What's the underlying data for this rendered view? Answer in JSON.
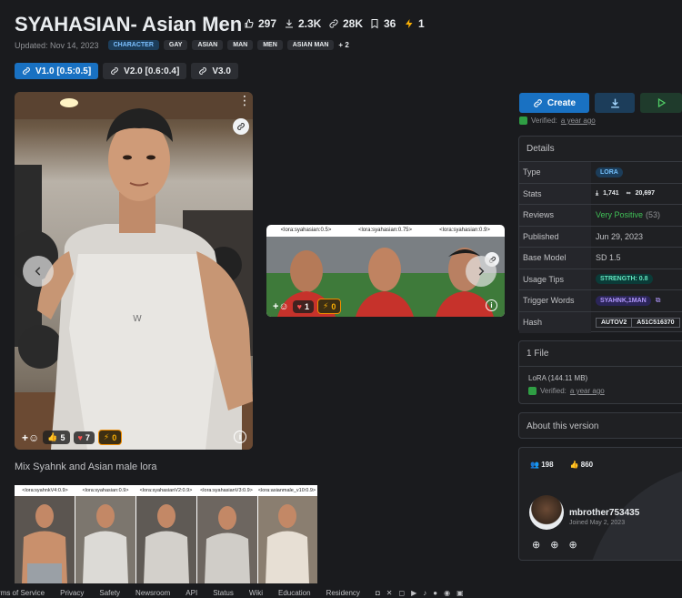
{
  "title": "SYAHASIAN- Asian Men",
  "stats": {
    "likes": "297",
    "downloads": "2.3K",
    "generations": "28K",
    "saves": "36",
    "buzz": "1"
  },
  "updated": "Updated: Nov 14, 2023",
  "tags": [
    "CHARACTER",
    "GAY",
    "ASIAN",
    "MAN",
    "MEN",
    "ASIAN MAN"
  ],
  "tags_more": "+ 2",
  "versions": [
    "V1.0 [0.5:0.5]",
    "V2.0 [0.6:0.4]",
    "V3.0"
  ],
  "main_image": {
    "reactions": {
      "thumbs": "5",
      "heart": "7",
      "buzz": "0"
    }
  },
  "grid_image": {
    "labels": [
      "<lora:syahasian:0.5>",
      "<lora:syahasian:0.75>",
      "<lora:syahasian:0.9>"
    ],
    "reactions": {
      "heart": "1",
      "buzz": "0"
    }
  },
  "description": "Mix Syahnk and Asian male lora",
  "strip_labels": [
    "<lora:syahnkV4:0.9>",
    "<lora:syahasian:0.9>",
    "<lora:syahasianV2:0.9>",
    "<lora:syahasianV3:0.9>",
    "<lora:asianmale_v10:0.9>"
  ],
  "sidebar": {
    "create_label": "Create",
    "verified_prefix": "Verified:",
    "verified_when": "a year ago",
    "details_title": "Details",
    "details": {
      "type_label": "Type",
      "type_value": "LORA",
      "stats_label": "Stats",
      "stats_downloads": "1,741",
      "stats_generations": "20,697",
      "reviews_label": "Reviews",
      "reviews_value": "Very Positive",
      "reviews_count": "(53)",
      "published_label": "Published",
      "published_value": "Jun 29, 2023",
      "base_label": "Base Model",
      "base_value": "SD 1.5",
      "usage_label": "Usage Tips",
      "usage_value": "STRENGTH: 0.8",
      "trigger_label": "Trigger Words",
      "trigger_value": "SYAHNK,1MAN",
      "hash_label": "Hash",
      "hash_type": "AUTOV2",
      "hash_value": "A51C516370"
    },
    "files_title": "1 File",
    "file_name": "LoRA (144.11 MB)",
    "about_title": "About this version",
    "creator": {
      "followers": "198",
      "likes": "860",
      "name": "mbrother753435",
      "joined": "Joined May 2, 2023"
    }
  },
  "footer": [
    "rms of Service",
    "Privacy",
    "Safety",
    "Newsroom",
    "API",
    "Status",
    "Wiki",
    "Education",
    "Residency"
  ],
  "colors": {
    "accent": "#1971c2",
    "positive": "#40c057",
    "background": "#1a1b1e"
  }
}
